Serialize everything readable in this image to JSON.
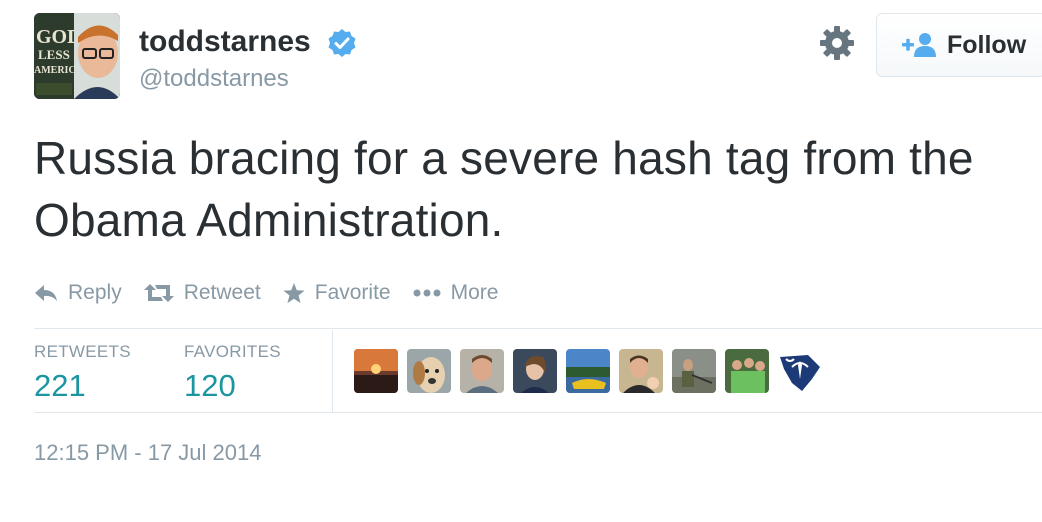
{
  "author": {
    "name": "toddstarnes",
    "handle": "@toddstarnes",
    "avatar_text": [
      "GOD",
      "LESS",
      "AMERICA"
    ]
  },
  "follow_button": {
    "label": "Follow"
  },
  "tweet": {
    "text": "Russia bracing for a severe hash tag from the Obama Administration."
  },
  "actions": {
    "reply": "Reply",
    "retweet": "Retweet",
    "favorite": "Favorite",
    "more": "More"
  },
  "stats": {
    "retweets_label": "RETWEETS",
    "retweets_value": "221",
    "favorites_label": "FAVORITES",
    "favorites_value": "120"
  },
  "timestamp": "12:15 PM - 17 Jul 2014",
  "colors": {
    "text": "#292f33",
    "muted": "#8899a6",
    "link": "#1b95a0",
    "verified": "#55acee",
    "follow_icon": "#55acee"
  }
}
